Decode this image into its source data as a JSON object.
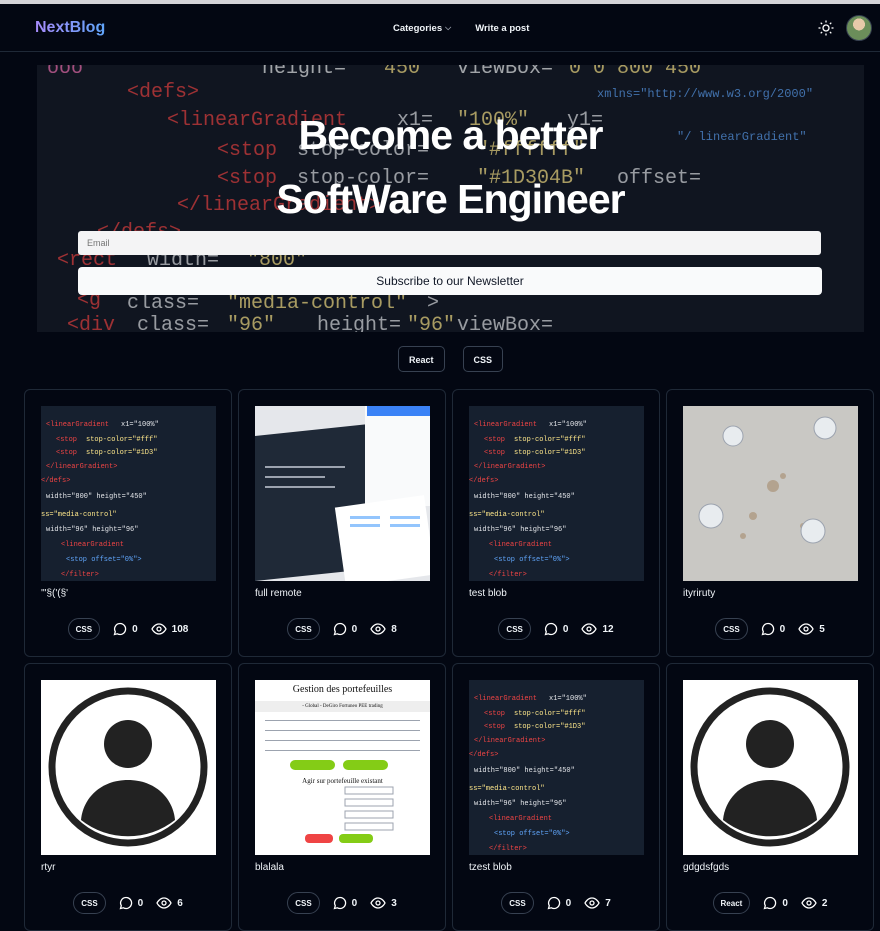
{
  "header": {
    "brand": "NextBlog",
    "nav": [
      "Categories",
      "Write a post"
    ]
  },
  "hero": {
    "line1": "Become a better",
    "line2": "SoftWare Engineer",
    "email_placeholder": "Email",
    "subscribe": "Subscribe to our Newsletter"
  },
  "tags": [
    "React",
    "CSS"
  ],
  "posts": [
    {
      "title": "'\"§('(§'",
      "tag": "CSS",
      "comments": "0",
      "views": "108"
    },
    {
      "title": "full remote",
      "tag": "CSS",
      "comments": "0",
      "views": "8"
    },
    {
      "title": "test blob",
      "tag": "CSS",
      "comments": "0",
      "views": "12"
    },
    {
      "title": "ityriruty",
      "tag": "CSS",
      "comments": "0",
      "views": "5"
    },
    {
      "title": "rtyr",
      "tag": "CSS",
      "comments": "0",
      "views": "6"
    },
    {
      "title": "blalala",
      "tag": "CSS",
      "comments": "0",
      "views": "3"
    },
    {
      "title": "tzest blob",
      "tag": "CSS",
      "comments": "0",
      "views": "7"
    },
    {
      "title": "gdgdsfgds",
      "tag": "React",
      "comments": "0",
      "views": "2"
    }
  ],
  "post_thumb_text": {
    "title": "Gestion des portefeuilles",
    "tabs": "- Global -   DeGiro   Fortuneo   PEE trading",
    "heading": "Agir sur portefeuille existant"
  }
}
